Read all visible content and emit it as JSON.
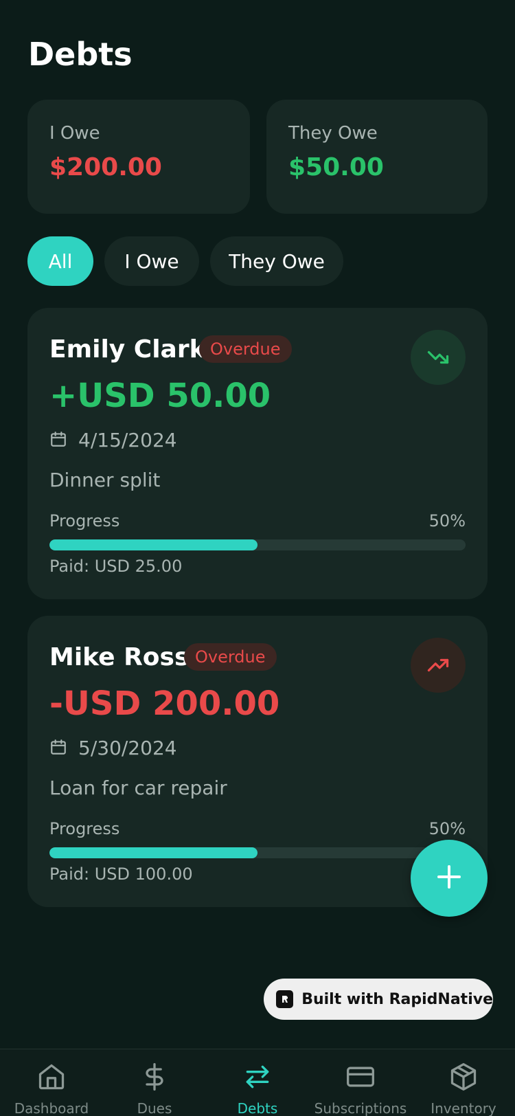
{
  "header": {
    "title": "Debts"
  },
  "summary": {
    "i_owe": {
      "label": "I Owe",
      "amount": "$200.00",
      "color": "#e94a4a"
    },
    "they_owe": {
      "label": "They Owe",
      "amount": "$50.00",
      "color": "#2ac26a"
    }
  },
  "filters": [
    {
      "label": "All",
      "active": true
    },
    {
      "label": "I Owe",
      "active": false
    },
    {
      "label": "They Owe",
      "active": false
    }
  ],
  "debts": [
    {
      "name": "Emily Clark",
      "status": "Overdue",
      "amount": "+USD 50.00",
      "amount_color": "#2ac26a",
      "trend_icon": "trending-down-icon",
      "date": "4/15/2024",
      "description": "Dinner split",
      "progress_label": "Progress",
      "progress_percent": "50%",
      "progress_value": 0.5,
      "paid": "Paid: USD 25.00"
    },
    {
      "name": "Mike Ross",
      "status": "Overdue",
      "amount": "-USD 200.00",
      "amount_color": "#e94a4a",
      "trend_icon": "trending-up-icon",
      "date": "5/30/2024",
      "description": "Loan for car repair",
      "progress_label": "Progress",
      "progress_percent": "50%",
      "progress_value": 0.5,
      "paid": "Paid: USD 100.00"
    }
  ],
  "fab": {
    "icon": "plus-icon"
  },
  "watermark": {
    "label": "Built with RapidNative"
  },
  "tabbar": [
    {
      "label": "Dashboard",
      "icon": "home-icon",
      "active": false
    },
    {
      "label": "Dues",
      "icon": "dollar-icon",
      "active": false
    },
    {
      "label": "Debts",
      "icon": "arrows-swap-icon",
      "active": true
    },
    {
      "label": "Subscriptions",
      "icon": "credit-card-icon",
      "active": false
    },
    {
      "label": "Inventory",
      "icon": "package-icon",
      "active": false
    }
  ],
  "colors": {
    "accent": "#2fd3c1",
    "background": "#0c1c19",
    "card": "#172824"
  }
}
